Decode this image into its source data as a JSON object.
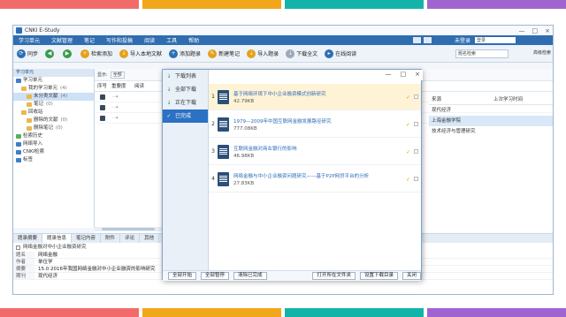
{
  "stripes": {
    "colors": [
      "#f26b6b",
      "#f2a71b",
      "#12b3a8",
      "#a064d1"
    ]
  },
  "window": {
    "title": "CNKI E-Study",
    "controls": [
      "—",
      "□",
      "×"
    ]
  },
  "menu": {
    "items": [
      "学习单元",
      "文献管理",
      "笔记",
      "写作和投稿",
      "阅读",
      "工具",
      "帮助"
    ],
    "user_label": "未登录",
    "user_box": "登录"
  },
  "toolbar": {
    "buttons": [
      {
        "label": "同步",
        "color": "#2c6fb5",
        "glyph": "⟳"
      },
      {
        "label": "",
        "color": "#3a9a4a",
        "glyph": "◀"
      },
      {
        "label": "",
        "color": "#3a9a4a",
        "glyph": "▶"
      },
      {
        "label": "检索添加",
        "color": "#e3a21d",
        "glyph": "+"
      },
      {
        "label": "导入本地文献",
        "color": "#e3a21d",
        "glyph": "↓"
      },
      {
        "label": "添加题录",
        "color": "#2c6fb5",
        "glyph": "+"
      },
      {
        "label": "新建笔记",
        "color": "#e3a21d",
        "glyph": "✎"
      },
      {
        "label": "导入题录",
        "color": "#e3a21d",
        "glyph": "⇣"
      },
      {
        "label": "下载全文",
        "color": "#9aa9bb",
        "glyph": "↓"
      },
      {
        "label": "在线阅读",
        "color": "#2c6fb5",
        "glyph": "▸"
      }
    ],
    "search_placeholder": "题名检索",
    "advanced": "高级检索"
  },
  "sidebar": {
    "header": "学习单元",
    "items": [
      {
        "label": "学习单元",
        "indent": 0,
        "icon": "blue",
        "count": "",
        "selected": false
      },
      {
        "label": "我的学习单元",
        "indent": 1,
        "icon": "yellow",
        "count": "(4)",
        "selected": false
      },
      {
        "label": "未分类文献",
        "indent": 2,
        "icon": "yellow",
        "count": "(4)",
        "selected": true
      },
      {
        "label": "笔记",
        "indent": 2,
        "icon": "yellow",
        "count": "(0)",
        "selected": false
      },
      {
        "label": "回收站",
        "indent": 1,
        "icon": "yellow",
        "count": "",
        "selected": false
      },
      {
        "label": "删除的文献",
        "indent": 2,
        "icon": "yellow",
        "count": "(0)",
        "selected": false
      },
      {
        "label": "删除笔记",
        "indent": 2,
        "icon": "yellow",
        "count": "(0)",
        "selected": false
      },
      {
        "label": "检索历史",
        "indent": 0,
        "icon": "green",
        "count": "",
        "selected": false
      },
      {
        "label": "网络导入",
        "indent": 0,
        "icon": "blue",
        "count": "",
        "selected": false
      },
      {
        "label": "CNKI检索",
        "indent": 0,
        "icon": "blue",
        "count": "",
        "selected": false
      },
      {
        "label": "标签",
        "indent": 0,
        "icon": "blue",
        "count": "",
        "selected": false
      }
    ]
  },
  "list": {
    "toolbar_label": "显示:",
    "toolbar_dropdown": "全部",
    "columns": [
      "序号",
      "重要度",
      "阅读"
    ],
    "rows": [
      {
        "stars": "··✦"
      },
      {
        "stars": "··✦"
      },
      {
        "stars": "··✦"
      }
    ],
    "right_columns": [
      "来源",
      "上次学习时间"
    ],
    "right_rows": [
      {
        "source": "现代经济",
        "time": "",
        "selected": false
      },
      {
        "source": "上海金融学院",
        "time": "",
        "selected": true
      },
      {
        "source": "技术经济与管理研究",
        "time": "",
        "selected": false
      }
    ]
  },
  "bottom": {
    "tabs": [
      "题录摘要",
      "题录信息",
      "笔记内容",
      "附件",
      "评论",
      "其他"
    ],
    "active_tab": 1,
    "title": "网络金融对中小企业融资研究",
    "fields": [
      {
        "k": "题名",
        "v": "网络金融"
      },
      {
        "k": "作者",
        "v": "单位学"
      },
      {
        "k": "摘要",
        "v": "15.0 2016年我国网络金融对中小企业融资的影响研究"
      },
      {
        "k": "期刊",
        "v": "现代经济"
      }
    ]
  },
  "dialog": {
    "controls": [
      "—",
      "□",
      "×"
    ],
    "nav": [
      {
        "label": "下载列表",
        "icon": "↓",
        "color": "#2b9b4a",
        "selected": false
      },
      {
        "label": "全部下载",
        "icon": "↓",
        "color": "#2b9b4a",
        "selected": false
      },
      {
        "label": "正在下载",
        "icon": "↓",
        "color": "#2b9b4a",
        "selected": false
      },
      {
        "label": "已完成",
        "icon": "✓",
        "color": "#ffffff",
        "selected": true
      }
    ],
    "items": [
      {
        "idx": "1",
        "name": "基于网络环境下中小企业融资模式创新研究",
        "size": "42.79KB",
        "highlight": true
      },
      {
        "idx": "2",
        "name": "1979—2009年中国互联网金融发展路径研究",
        "size": "777.08KB",
        "highlight": false
      },
      {
        "idx": "3",
        "name": "互联网金融对商业银行的影响",
        "size": "46.98KB",
        "highlight": false
      },
      {
        "idx": "4",
        "name": "网络金融与中小企业融资问题研究——基于P2P网贷平台的分析",
        "size": "27.83KB",
        "highlight": false
      }
    ],
    "footer_buttons_left": [
      "全部开始",
      "全部暂停",
      "清除已完成"
    ],
    "footer_buttons_right": [
      "打开所在文件夹",
      "设置下载目录",
      "关闭"
    ]
  }
}
